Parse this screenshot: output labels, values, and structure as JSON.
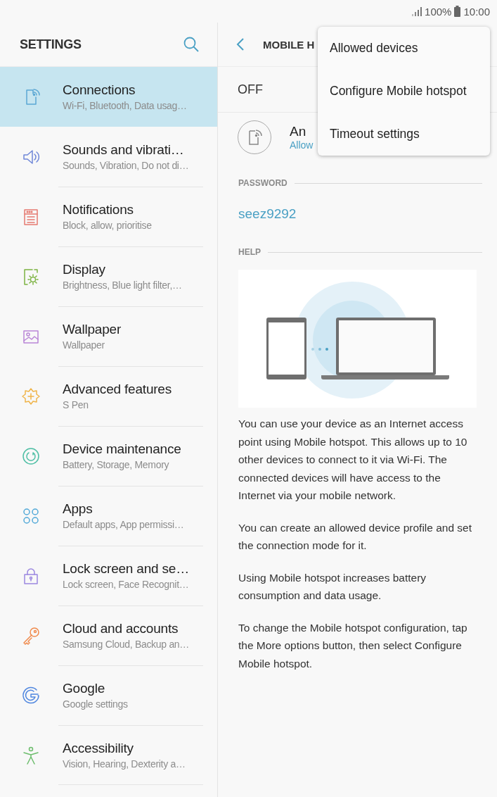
{
  "status_bar": {
    "battery": "100%",
    "time": "10:00"
  },
  "sidebar": {
    "title": "SETTINGS",
    "items": [
      {
        "title": "Connections",
        "subtitle": "Wi-Fi, Bluetooth, Data usag…",
        "selected": true
      },
      {
        "title": "Sounds and vibrati…",
        "subtitle": "Sounds, Vibration, Do not di…",
        "selected": false
      },
      {
        "title": "Notifications",
        "subtitle": "Block, allow, prioritise",
        "selected": false
      },
      {
        "title": "Display",
        "subtitle": "Brightness, Blue light filter,…",
        "selected": false
      },
      {
        "title": "Wallpaper",
        "subtitle": "Wallpaper",
        "selected": false
      },
      {
        "title": "Advanced features",
        "subtitle": "S Pen",
        "selected": false
      },
      {
        "title": "Device maintenance",
        "subtitle": "Battery, Storage, Memory",
        "selected": false
      },
      {
        "title": "Apps",
        "subtitle": "Default apps, App permissi…",
        "selected": false
      },
      {
        "title": "Lock screen and se…",
        "subtitle": "Lock screen, Face Recognit…",
        "selected": false
      },
      {
        "title": "Cloud and accounts",
        "subtitle": "Samsung Cloud, Backup an…",
        "selected": false
      },
      {
        "title": "Google",
        "subtitle": "Google settings",
        "selected": false
      },
      {
        "title": "Accessibility",
        "subtitle": "Vision, Hearing, Dexterity a…",
        "selected": false
      }
    ]
  },
  "detail": {
    "title": "MOBILE H",
    "switch_label": "OFF",
    "network": {
      "title": "An",
      "subtitle": "Allow"
    },
    "password_label": "PASSWORD",
    "password": "seez9292",
    "help_label": "HELP",
    "help_paragraphs": [
      "You can use your device as an Internet access point using Mobile hotspot. This allows up to 10 other devices to connect to it via Wi-Fi. The connected devices will have access to the Internet via your mobile network.",
      "You can create an allowed device profile and set the connection mode for it.",
      "Using Mobile hotspot increases battery consumption and data usage.",
      "To change the Mobile hotspot configuration, tap the More options button, then select Configure Mobile hotspot."
    ]
  },
  "menu": {
    "items": [
      "Allowed devices",
      "Configure Mobile hotspot",
      "Timeout settings"
    ]
  }
}
